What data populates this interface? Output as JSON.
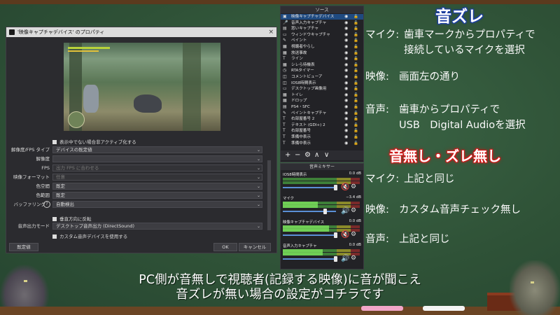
{
  "dialog": {
    "title": "'映像キャプチャデバイス' のプロパティ",
    "close": "×",
    "checkbox_inactive": "表示中でない場合非アクティブ化する",
    "fields": [
      {
        "label": "解像度/FPS タイプ",
        "value": "デバイスの既定値",
        "disabled": false
      },
      {
        "label": "解像度",
        "value": "",
        "disabled": false
      },
      {
        "label": "FPS",
        "value": "出力 FPS に合わせる",
        "disabled": true
      },
      {
        "label": "映像フォーマット",
        "value": "任意",
        "disabled": true
      },
      {
        "label": "色空間",
        "value": "既定",
        "disabled": false
      },
      {
        "label": "色範囲",
        "value": "既定",
        "disabled": false
      },
      {
        "label": "バッファリング",
        "value": "自動検出",
        "disabled": false
      }
    ],
    "checkbox_flip": "垂直方向に反転",
    "audio_mode_label": "音声出力モード",
    "audio_mode_value": "デスクトップ音声出力 (DirectSound)",
    "checkbox_custom_audio": "カスタム音声デバイスを使用する",
    "defaults_button": "既定値",
    "ok_button": "OK",
    "cancel_button": "キャンセル"
  },
  "sources": {
    "header": "ソース",
    "items": [
      {
        "icon": "camera-icon",
        "glyph": "▣",
        "name": "映像キャプチャデバイス",
        "selected": true
      },
      {
        "icon": "mic-icon",
        "glyph": "🎤",
        "name": "音声入力キャプチャ",
        "selected": false
      },
      {
        "icon": "game-icon",
        "glyph": "▤",
        "name": "窓いキャプチャ",
        "selected": false
      },
      {
        "icon": "window-icon",
        "glyph": "▭",
        "name": "ウィンドウキャプチャ",
        "selected": false
      },
      {
        "icon": "brush-icon",
        "glyph": "✎",
        "name": "ペイント",
        "selected": false
      },
      {
        "icon": "image-icon",
        "glyph": "▦",
        "name": "視聴者やらし",
        "selected": false
      },
      {
        "icon": "image-icon",
        "glyph": "▦",
        "name": "放送事故",
        "selected": false
      },
      {
        "icon": "text-icon",
        "glyph": "T",
        "name": "ライン",
        "selected": false
      },
      {
        "icon": "image-icon",
        "glyph": "▦",
        "name": "シレら待機表",
        "selected": false
      },
      {
        "icon": "timer-icon",
        "glyph": "◷",
        "name": "RTAタイマー",
        "selected": false
      },
      {
        "icon": "browser-icon",
        "glyph": "◫",
        "name": "コメントビューア",
        "selected": false
      },
      {
        "icon": "browser-icon",
        "glyph": "◫",
        "name": "IOS8時間表示",
        "selected": false
      },
      {
        "icon": "window-icon",
        "glyph": "▭",
        "name": "デスクトップ画像用",
        "selected": false
      },
      {
        "icon": "image-icon",
        "glyph": "▦",
        "name": "トイレ",
        "selected": false
      },
      {
        "icon": "image-icon",
        "glyph": "▦",
        "name": "ドロップ",
        "selected": false
      },
      {
        "icon": "game-icon",
        "glyph": "▤",
        "name": "PS4・SFC",
        "selected": false
      },
      {
        "icon": "brush-icon",
        "glyph": "✎",
        "name": "ペイントキャプチャ",
        "selected": false
      },
      {
        "icon": "text-icon",
        "glyph": "T",
        "name": "右部屋番号 2",
        "selected": false
      },
      {
        "icon": "text-icon",
        "glyph": "T",
        "name": "テキスト (GDI+) 2",
        "selected": false
      },
      {
        "icon": "text-icon",
        "glyph": "T",
        "name": "右部屋番号",
        "selected": false
      },
      {
        "icon": "text-icon",
        "glyph": "T",
        "name": "準備中表示",
        "selected": false
      },
      {
        "icon": "text-icon",
        "glyph": "T",
        "name": "準備中表示",
        "selected": false
      }
    ],
    "toolbar": [
      "+",
      "−",
      "⚙",
      "∧",
      "∨"
    ]
  },
  "mixer": {
    "header": "音声ミキサー",
    "channels": [
      {
        "name": "IOS8時間表示",
        "db": "0.0 dB",
        "level": 0.0,
        "volume": 0.98,
        "muted": true
      },
      {
        "name": "マイク",
        "db": "−3.4 dB",
        "level": 0.45,
        "volume": 0.78,
        "muted": false
      },
      {
        "name": "映像キャプチャデバイス",
        "db": "0.0 dB",
        "level": 0.6,
        "volume": 0.98,
        "muted": true
      },
      {
        "name": "音声入力キャプチャ",
        "db": "0.0 dB",
        "level": 0.52,
        "volume": 0.98,
        "muted": false
      }
    ]
  },
  "notes": {
    "heading1": "音ズレ",
    "mic_label": "マイク:",
    "mic_text1": "歯車マークからプロパティで",
    "mic_text2": "接続しているマイクを選択",
    "video_label": "映像:",
    "video_text": "画面左の通り",
    "audio_label": "音声:",
    "audio_text1": "歯車からプロパティで",
    "audio_text2": "USB　Digital Audioを選択",
    "heading2": "音無し・ズレ無し",
    "mic2_label": "マイク:",
    "mic2_text": "上記と同じ",
    "video2_label": "映像:",
    "video2_text": "カスタム音声チェック無し",
    "audio2_label": "音声:",
    "audio2_text": "上記と同じ"
  },
  "caption": {
    "line1": "PC側が音無しで視聴者(記録する映像)に音が聞こえ",
    "line2": "音ズレが無い場合の設定がコチラです"
  },
  "colors": {
    "selected": "#1f4a80",
    "mute": "#e02020",
    "speaker": "#e8e8e8"
  }
}
